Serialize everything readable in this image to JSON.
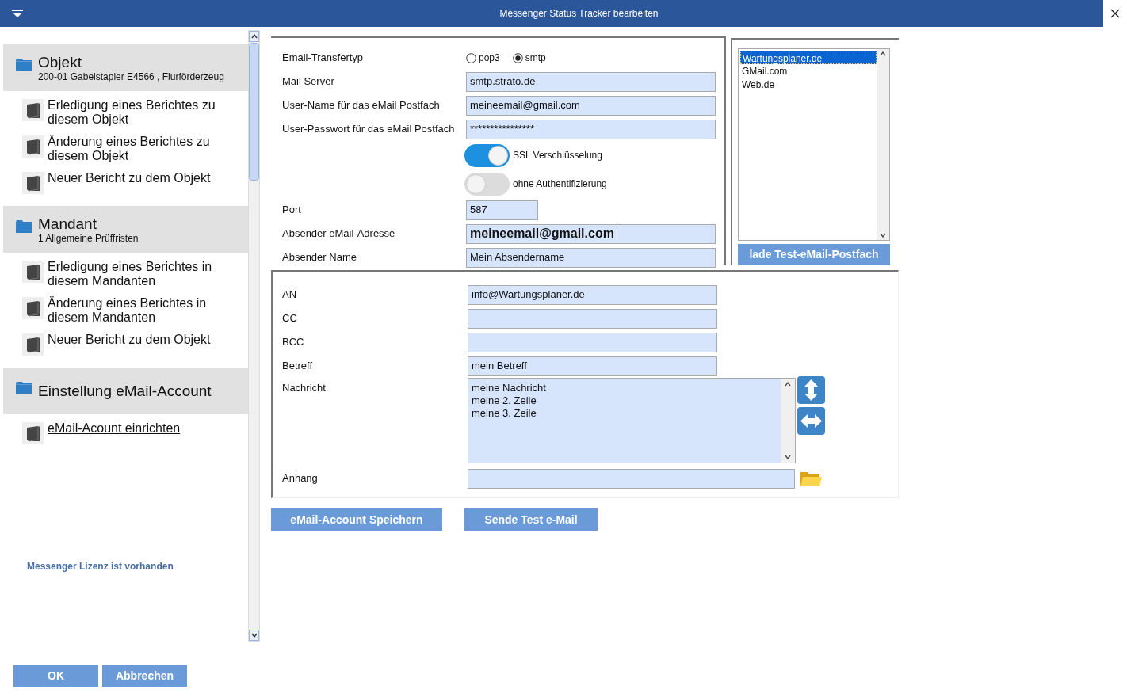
{
  "window": {
    "title": "Messenger Status Tracker bearbeiten"
  },
  "sidebar": {
    "sections": [
      {
        "title": "Objekt",
        "subtitle": "200-01 Gabelstapler E4566 , Flurförderzeug",
        "items": [
          {
            "label": "Erledigung eines Berichtes zu diesem Objekt",
            "link": false
          },
          {
            "label": "Änderung eines Berichtes zu diesem Objekt",
            "link": false
          },
          {
            "label": "Neuer Bericht zu dem Objekt",
            "link": false
          }
        ]
      },
      {
        "title": "Mandant",
        "subtitle": "1 Allgemeine Prüffristen",
        "items": [
          {
            "label": "Erledigung  eines Berichtes in diesem Mandanten",
            "link": false
          },
          {
            "label": "Änderung eines Berichtes in diesem Mandanten",
            "link": false
          },
          {
            "label": "Neuer Bericht zu dem Objekt",
            "link": false
          }
        ]
      },
      {
        "title": "Einstellung eMail-Account",
        "items": [
          {
            "label": "eMail-Acount einrichten",
            "link": true
          }
        ]
      }
    ],
    "license_note": "Messenger Lizenz ist vorhanden"
  },
  "account_form": {
    "rows": [
      {
        "kind": "radio",
        "label": "Email-Transfertyp",
        "options": [
          {
            "label": "pop3",
            "selected": false
          },
          {
            "label": "smtp",
            "selected": true
          }
        ]
      },
      {
        "kind": "text",
        "label": "Mail Server",
        "value": "smtp.strato.de",
        "focused": false
      },
      {
        "kind": "text",
        "label": "User-Name für das eMail Postfach",
        "value": "meineemail@gmail.com",
        "focused": false
      },
      {
        "kind": "text",
        "label": "User-Passwort für das eMail Postfach",
        "value": "****************",
        "focused": false
      },
      {
        "kind": "toggle",
        "label": "SSL Verschlüsselung",
        "on": true
      },
      {
        "kind": "toggle",
        "label": "ohne Authentifizierung",
        "on": false
      },
      {
        "kind": "number",
        "label": "Port",
        "value": "587",
        "focused": false
      },
      {
        "kind": "text",
        "label": "Absender eMail-Adresse",
        "value": "meineemail@gmail.com",
        "focused": true
      },
      {
        "kind": "text",
        "label": "Absender Name",
        "value": "Mein Absendername",
        "focused": false
      }
    ]
  },
  "providers": {
    "items": [
      {
        "label": "Wartungsplaner.de",
        "selected": true
      },
      {
        "label": "GMail.com",
        "selected": false
      },
      {
        "label": "Web.de",
        "selected": false
      }
    ],
    "button": "lade Test-eMail-Postfach"
  },
  "message_form": {
    "rows": [
      {
        "kind": "text",
        "label": "AN",
        "value": "info@Wartungsplaner.de"
      },
      {
        "kind": "text",
        "label": "CC"
      },
      {
        "kind": "text",
        "label": "BCC"
      },
      {
        "kind": "text",
        "label": "Betreff",
        "value": "mein Betreff"
      },
      {
        "kind": "textarea",
        "label": "Nachricht",
        "lines": [
          "meine Nachricht",
          "meine 2. Zeile",
          "meine 3. Zeile"
        ]
      },
      {
        "kind": "file",
        "label": "Anhang"
      }
    ]
  },
  "actions": [
    "eMail-Account Speichern",
    "Sende Test e-Mail"
  ],
  "dialog_buttons": [
    "OK",
    "Abbrechen"
  ]
}
